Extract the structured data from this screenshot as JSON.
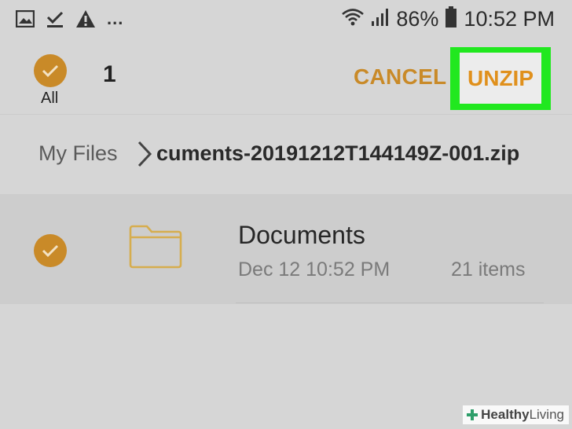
{
  "status_bar": {
    "notification_icons": [
      "image-icon",
      "download-check-icon",
      "warning-icon"
    ],
    "overflow": "...",
    "battery_percent": "86%",
    "time": "10:52 PM"
  },
  "action_bar": {
    "select_all_label": "All",
    "selected_count": "1",
    "cancel_label": "CANCEL",
    "unzip_label": "UNZIP"
  },
  "breadcrumb": {
    "root": "My Files",
    "current": "cuments-20191212T144149Z-001.zip"
  },
  "files": [
    {
      "name": "Documents",
      "date": "Dec 12 10:52 PM",
      "item_count": "21 items",
      "selected": true
    }
  ],
  "watermark": {
    "brand_bold": "Healthy",
    "brand_rest": "Living"
  },
  "colors": {
    "accent": "#c98a28",
    "highlight": "#21e81f",
    "background": "#d6d6d6"
  }
}
